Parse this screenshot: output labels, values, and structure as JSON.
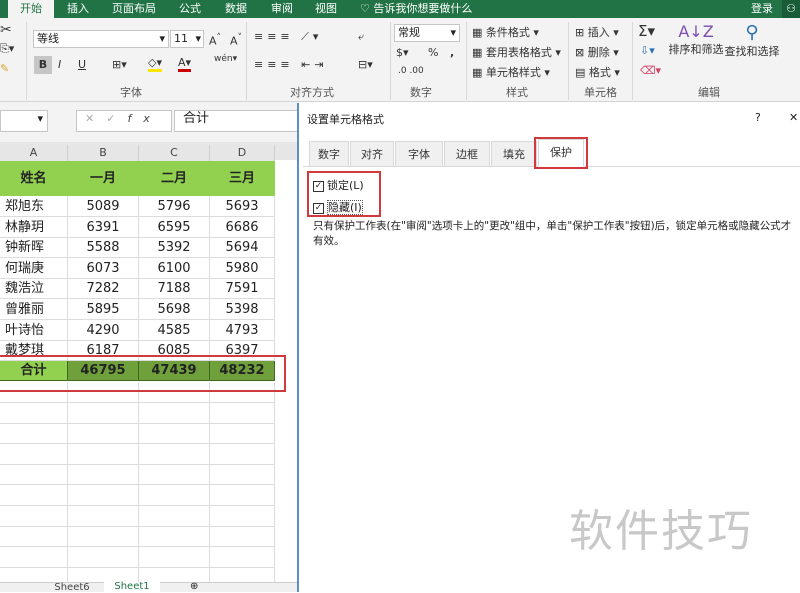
{
  "ribbon": {
    "tabs": [
      "开始",
      "插入",
      "页面布局",
      "公式",
      "数据",
      "审阅",
      "视图"
    ],
    "tell_me": "告诉我你想要做什么",
    "login": "登录",
    "font_name": "等线",
    "font_size": "11",
    "bold": "B",
    "italic": "I",
    "underline": "U",
    "number_format": "常规",
    "percent": "%",
    "comma": ",",
    "groups": {
      "font": "字体",
      "align": "对齐方式",
      "number": "数字",
      "styles": "样式",
      "cells": "单元格",
      "editing": "编辑"
    },
    "styles": [
      "条件格式",
      "套用表格格式",
      "单元格样式"
    ],
    "cells": [
      "插入",
      "删除",
      "格式"
    ],
    "sort": "排序和筛选",
    "find": "查找和选择"
  },
  "formula_bar": {
    "fx": "fx",
    "value": "合计"
  },
  "sheet": {
    "columns": [
      "A",
      "B",
      "C",
      "D"
    ],
    "header": [
      "姓名",
      "一月",
      "二月",
      "三月"
    ],
    "rows": [
      [
        "郑旭东",
        "5089",
        "5796",
        "5693"
      ],
      [
        "林静玥",
        "6391",
        "6595",
        "6686"
      ],
      [
        "钟新晖",
        "5588",
        "5392",
        "5694"
      ],
      [
        "何瑞庚",
        "6073",
        "6100",
        "5980"
      ],
      [
        "魏浩泣",
        "7282",
        "7188",
        "7591"
      ],
      [
        "曾雅丽",
        "5895",
        "5698",
        "5398"
      ],
      [
        "叶诗怡",
        "4290",
        "4585",
        "4793"
      ],
      [
        "戴梦琪",
        "6187",
        "6085",
        "6397"
      ]
    ],
    "total": [
      "合计",
      "46795",
      "47439",
      "48232"
    ],
    "tabs": [
      "Sheet6",
      "Sheet1"
    ]
  },
  "dialog": {
    "title": "设置单元格格式",
    "help": "?",
    "close": "✕",
    "tabs": [
      "数字",
      "对齐",
      "字体",
      "边框",
      "填充",
      "保护"
    ],
    "locked": "锁定(L)",
    "hidden": "隐藏(I)",
    "note": "只有保护工作表(在\"审阅\"选项卡上的\"更改\"组中，单击\"保护工作表\"按钮)后，锁定单元格或隐藏公式才有效。"
  },
  "watermark": "软件技巧",
  "colors": {
    "green": "#217346",
    "header_fill": "#92d050",
    "total_fill": "#6fa03c",
    "red": "#d0393d"
  }
}
